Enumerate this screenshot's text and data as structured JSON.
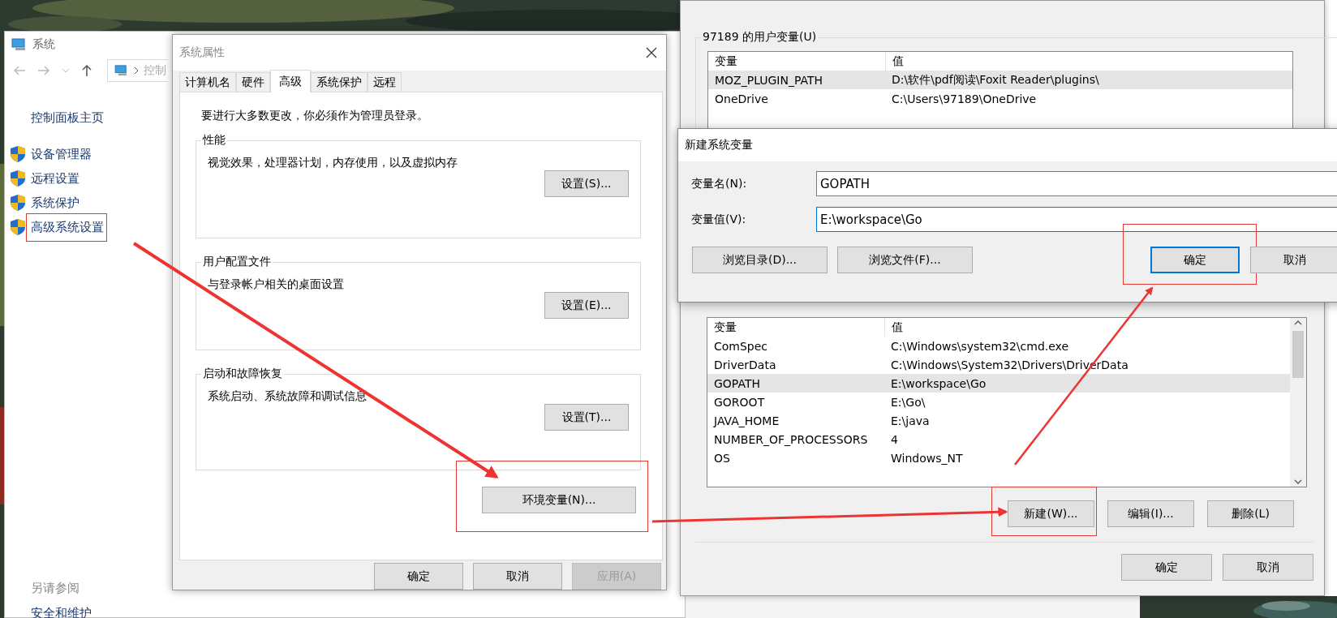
{
  "system_window": {
    "title": "系统",
    "address": "控制",
    "home_link": "控制面板主页",
    "links": [
      {
        "label": "设备管理器",
        "highlighted": false
      },
      {
        "label": "远程设置",
        "highlighted": false
      },
      {
        "label": "系统保护",
        "highlighted": false
      },
      {
        "label": "高级系统设置",
        "highlighted": true
      }
    ],
    "see_also": "另请参阅",
    "see_also_links": [
      "安全和维护"
    ]
  },
  "system_properties": {
    "title": "系统属性",
    "tabs": [
      {
        "label": "计算机名",
        "selected": false
      },
      {
        "label": "硬件",
        "selected": false
      },
      {
        "label": "高级",
        "selected": true
      },
      {
        "label": "系统保护",
        "selected": false
      },
      {
        "label": "远程",
        "selected": false
      }
    ],
    "notice": "要进行大多数更改，你必须作为管理员登录。",
    "groups": [
      {
        "title": "性能",
        "description": "视觉效果，处理器计划，内存使用，以及虚拟内存",
        "button": "设置(S)..."
      },
      {
        "title": "用户配置文件",
        "description": "与登录帐户相关的桌面设置",
        "button": "设置(E)..."
      },
      {
        "title": "启动和故障恢复",
        "description": "系统启动、系统故障和调试信息",
        "button": "设置(T)..."
      }
    ],
    "env_button": {
      "label": "环境变量(N)...",
      "highlighted": true
    },
    "buttons": [
      {
        "label": "确定",
        "disabled": false
      },
      {
        "label": "取消",
        "disabled": false
      },
      {
        "label": "应用(A)",
        "disabled": true
      }
    ]
  },
  "environment_variables": {
    "user_group": "97189 的用户变量(U)",
    "user_columns": [
      "变量",
      "值"
    ],
    "user_rows": [
      {
        "name": "MOZ_PLUGIN_PATH",
        "value": "D:\\软件\\pdf阅读\\Foxit Reader\\plugins\\",
        "selected": true
      },
      {
        "name": "OneDrive",
        "value": "C:\\Users\\97189\\OneDrive",
        "selected": false
      }
    ],
    "system_columns": [
      "变量",
      "值"
    ],
    "system_rows": [
      {
        "name": "ComSpec",
        "value": "C:\\Windows\\system32\\cmd.exe",
        "selected": false
      },
      {
        "name": "DriverData",
        "value": "C:\\Windows\\System32\\Drivers\\DriverData",
        "selected": false
      },
      {
        "name": "GOPATH",
        "value": "E:\\workspace\\Go",
        "selected": true
      },
      {
        "name": "GOROOT",
        "value": "E:\\Go\\",
        "selected": false
      },
      {
        "name": "JAVA_HOME",
        "value": "E:\\java",
        "selected": false
      },
      {
        "name": "NUMBER_OF_PROCESSORS",
        "value": "4",
        "selected": false
      },
      {
        "name": "OS",
        "value": "Windows_NT",
        "selected": false
      }
    ],
    "system_buttons": [
      {
        "label": "新建(W)...",
        "highlighted": true
      },
      {
        "label": "编辑(I)...",
        "highlighted": false
      },
      {
        "label": "删除(L)",
        "highlighted": false
      }
    ],
    "buttons": [
      "确定",
      "取消"
    ]
  },
  "new_variable_dialog": {
    "title": "新建系统变量",
    "fields": [
      {
        "label": "变量名(N):",
        "value": "GOPATH",
        "focused": false
      },
      {
        "label": "变量值(V):",
        "value": "E:\\workspace\\Go",
        "focused": true
      }
    ],
    "buttons": [
      {
        "label": "浏览目录(D)...",
        "default": false,
        "highlighted": false
      },
      {
        "label": "浏览文件(F)...",
        "default": false,
        "highlighted": false
      },
      {
        "label": "确定",
        "default": true,
        "highlighted": true
      },
      {
        "label": "取消",
        "default": false,
        "highlighted": false
      }
    ]
  }
}
